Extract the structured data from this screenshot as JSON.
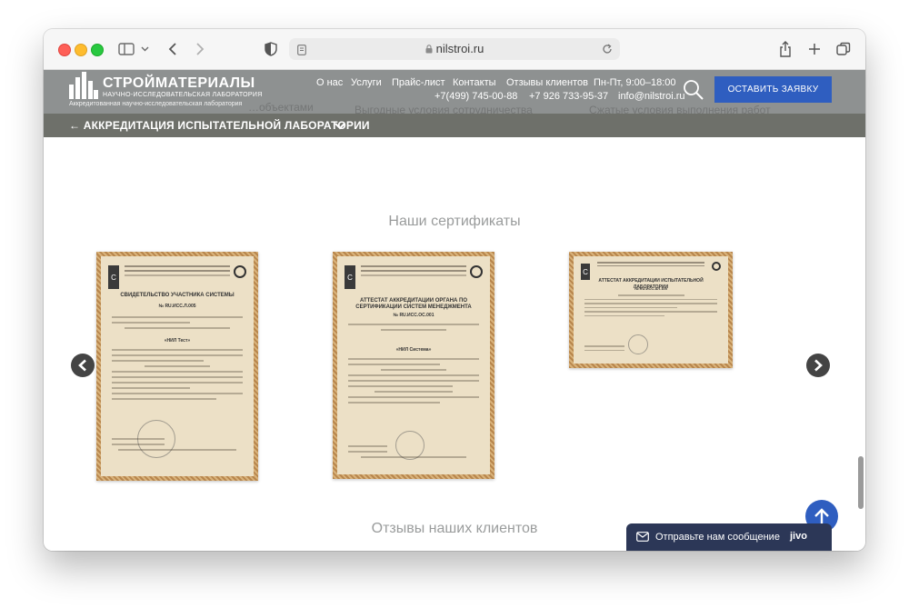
{
  "browser": {
    "url": "nilstroi.ru"
  },
  "header": {
    "logo_title": "СТРОЙМАТЕРИАЛЫ",
    "logo_subtitle": "НАУЧНО-ИССЛЕДОВАТЕЛЬСКАЯ ЛАБОРАТОРИЯ",
    "logo_caption": "Аккредитованная научно-исследовательская лаборатория",
    "nav": [
      "О нас",
      "Услуги",
      "Прайс-лист",
      "Контакты",
      "Отзывы клиентов"
    ],
    "hours": "Пн-Пт, 9:00–18:00",
    "phone1": "+7(499) 745-00-88",
    "phone2": "+7 926 733-95-37",
    "email": "info@nilstroi.ru",
    "cta": "ОСТАВИТЬ ЗАЯВКУ",
    "ghost_texts": [
      "…объектами",
      "Выгодные условия сотрудничества",
      "Сжатые условия выполнения работ"
    ]
  },
  "subnav": {
    "label": "← АККРЕДИТАЦИЯ ИСПЫТАТЕЛЬНОЙ ЛАБОРАТОРИИ"
  },
  "certificates_section": {
    "title": "Наши сертификаты",
    "items": [
      {
        "title": "СВИДЕТЕЛЬСТВО УЧАСТНИКА СИСТЕМЫ",
        "number": "№ RU.ИСС.Л.005",
        "name": "«НИЛ Тест»"
      },
      {
        "title": "АТТЕСТАТ АККРЕДИТАЦИИ ОРГАНА ПО СЕРТИФИКАЦИИ СИСТЕМ МЕНЕДЖМЕНТА",
        "number": "№ RU.ИСС.ОС.001",
        "name": "«НИЛ Система»"
      },
      {
        "title": "АТТЕСТАТ АККРЕДИТАЦИИ ИСПЫТАТЕЛЬНОЙ ЛАБОРАТОРИИ",
        "number": "№ RU.ИСС.АЛ.105",
        "name": ""
      }
    ]
  },
  "reviews_section": {
    "title": "Отзывы наших клиентов"
  },
  "chat": {
    "label": "Отправьте нам сообщение",
    "brand": "jivo"
  }
}
